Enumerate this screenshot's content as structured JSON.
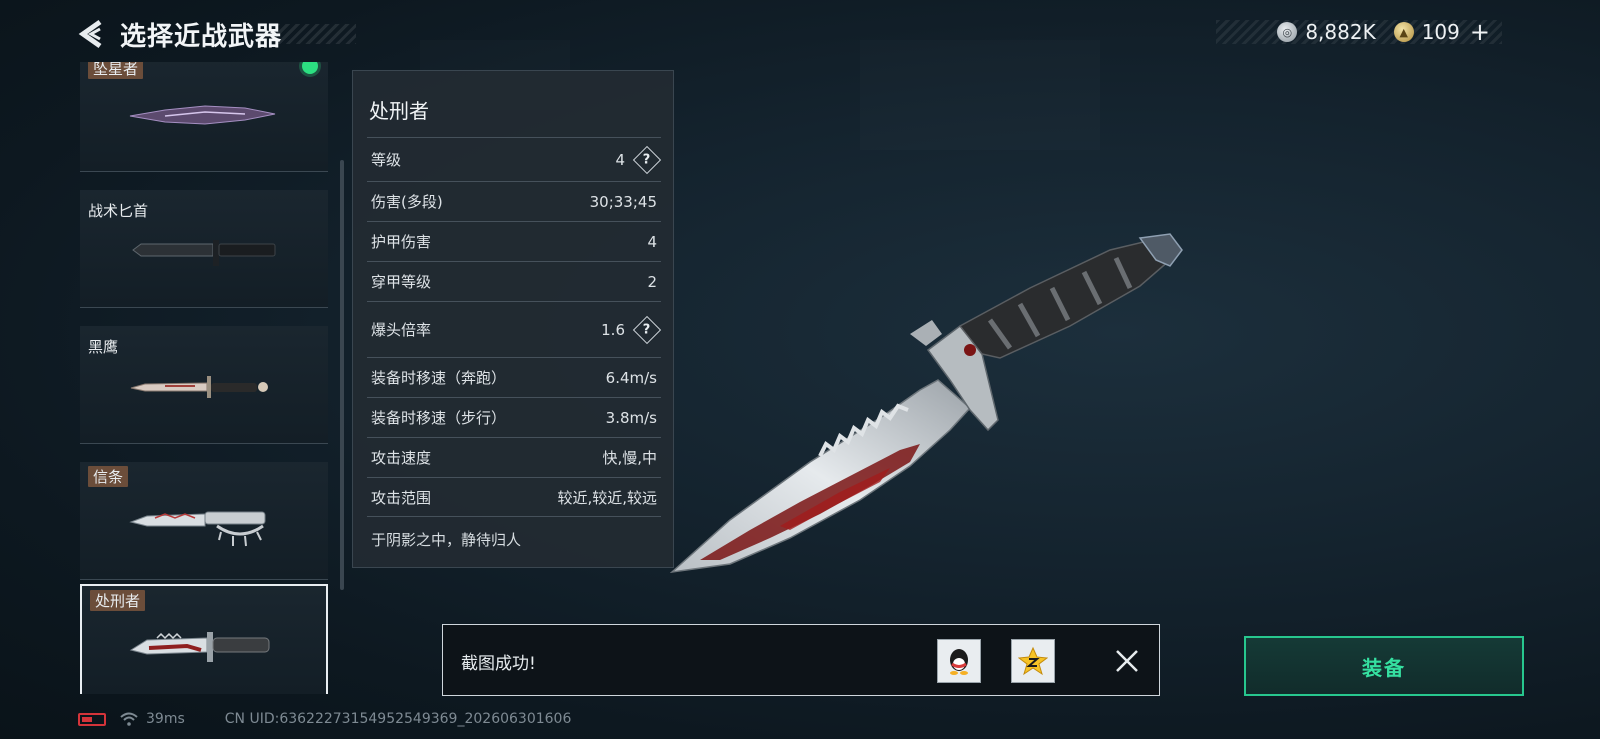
{
  "header": {
    "title": "选择近战武器",
    "currency": [
      {
        "icon": "silver-coin-icon",
        "value": "8,882K"
      },
      {
        "icon": "gold-coin-icon",
        "value": "109"
      }
    ],
    "add_label": "+"
  },
  "weapon_list": [
    {
      "name": "坠星者",
      "equipped": true,
      "selected": false
    },
    {
      "name": "战术匕首",
      "equipped": false,
      "selected": false
    },
    {
      "name": "黑鹰",
      "equipped": false,
      "selected": false
    },
    {
      "name": "信条",
      "equipped": false,
      "selected": false
    },
    {
      "name": "处刑者",
      "equipped": false,
      "selected": true
    }
  ],
  "detail": {
    "name": "处刑者",
    "stats": [
      {
        "label": "等级",
        "value": "4",
        "help": true
      },
      {
        "label": "伤害(多段)",
        "value": "30;33;45",
        "help": false
      },
      {
        "label": "护甲伤害",
        "value": "4",
        "help": false
      },
      {
        "label": "穿甲等级",
        "value": "2",
        "help": false
      },
      {
        "label": "爆头倍率",
        "value": "1.6",
        "help": true
      },
      {
        "label": "装备时移速（奔跑）",
        "value": "6.4m/s",
        "help": false
      },
      {
        "label": "装备时移速（步行）",
        "value": "3.8m/s",
        "help": false
      },
      {
        "label": "攻击速度",
        "value": "快,慢,中",
        "help": false
      },
      {
        "label": "攻击范围",
        "value": "较近,较近,较远",
        "help": false
      }
    ],
    "motto": "于阴影之中，静待归人"
  },
  "toast": {
    "message": "截图成功!",
    "share_icons": [
      "qq-icon",
      "qzone-icon"
    ],
    "close_icon": "close-icon"
  },
  "equip_button": {
    "label": "装备",
    "color": "#35e0a0"
  },
  "status_bar": {
    "ping": "39ms",
    "uid": "CN UID:6362227315495254936­9_202606301606",
    "battery_color": "#d4343a"
  }
}
